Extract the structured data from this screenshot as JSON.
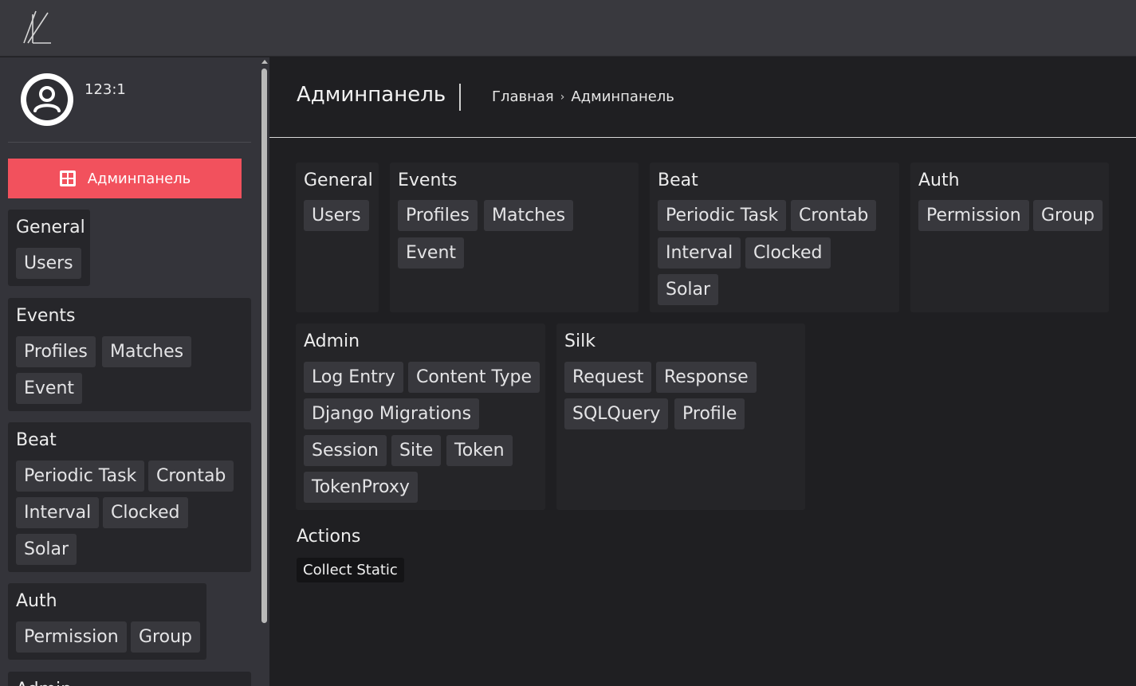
{
  "topbar": {
    "logo_icon": "logo-icon"
  },
  "user": {
    "name": "123:1",
    "avatar_icon": "user-avatar-icon"
  },
  "sidebar": {
    "admin_button": {
      "label": "Админпанель",
      "icon": "grid-icon",
      "color": "#f2515d"
    },
    "groups": [
      {
        "title": "General",
        "items": [
          "Users"
        ]
      },
      {
        "title": "Events",
        "items": [
          "Profiles",
          "Matches",
          "Event"
        ]
      },
      {
        "title": "Beat",
        "items": [
          "Periodic Task",
          "Crontab",
          "Interval",
          "Clocked",
          "Solar"
        ]
      },
      {
        "title": "Auth",
        "items": [
          "Permission",
          "Group"
        ]
      },
      {
        "title": "Admin",
        "items": []
      }
    ]
  },
  "header": {
    "title": "Админпанель",
    "breadcrumb": {
      "home": "Главная",
      "separator": "›",
      "current": "Админпанель"
    }
  },
  "main": {
    "groups": [
      {
        "title": "General",
        "items": [
          "Users"
        ]
      },
      {
        "title": "Events",
        "items": [
          "Profiles",
          "Matches",
          "Event"
        ]
      },
      {
        "title": "Beat",
        "items": [
          "Periodic Task",
          "Crontab",
          "Interval",
          "Clocked",
          "Solar"
        ]
      },
      {
        "title": "Auth",
        "items": [
          "Permission",
          "Group"
        ]
      },
      {
        "title": "Admin",
        "items": [
          "Log Entry",
          "Content Type",
          "Django Migrations",
          "Session",
          "Site",
          "Token",
          "TokenProxy"
        ]
      },
      {
        "title": "Silk",
        "items": [
          "Request",
          "Response",
          "SQLQuery",
          "Profile"
        ]
      }
    ],
    "actions": {
      "title": "Actions",
      "items": [
        "Collect Static"
      ]
    }
  }
}
